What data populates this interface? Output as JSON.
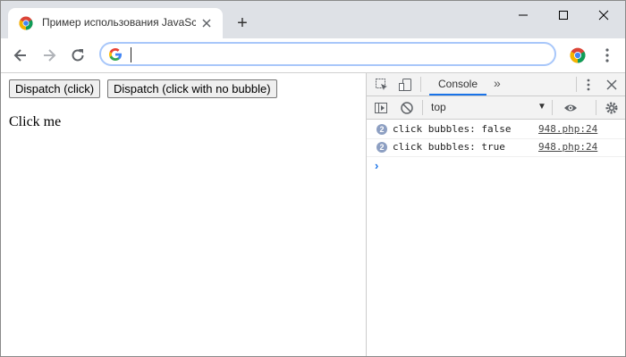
{
  "browser": {
    "tab": {
      "title": "Пример использования JavaScr",
      "close_icon": "close-icon"
    },
    "new_tab_label": "+",
    "omnibox": {
      "value": "",
      "placeholder": ""
    }
  },
  "page": {
    "buttons": {
      "dispatch_click": "Dispatch (click)",
      "dispatch_no_bubble": "Dispatch (click with no bubble)"
    },
    "text": "Click me"
  },
  "devtools": {
    "active_tab": "Console",
    "more_tabs": "»",
    "context": "top",
    "logs": [
      {
        "count": "2",
        "message": "click bubbles: false",
        "source": "948.php:24"
      },
      {
        "count": "2",
        "message": "click bubbles: true",
        "source": "948.php:24"
      }
    ],
    "prompt": "›"
  },
  "colors": {
    "tabstrip": "#dee1e6",
    "omnibox_border": "#a8c7fa",
    "console_tab_underline": "#1a73e8",
    "log_badge": "#8d9fc2"
  }
}
